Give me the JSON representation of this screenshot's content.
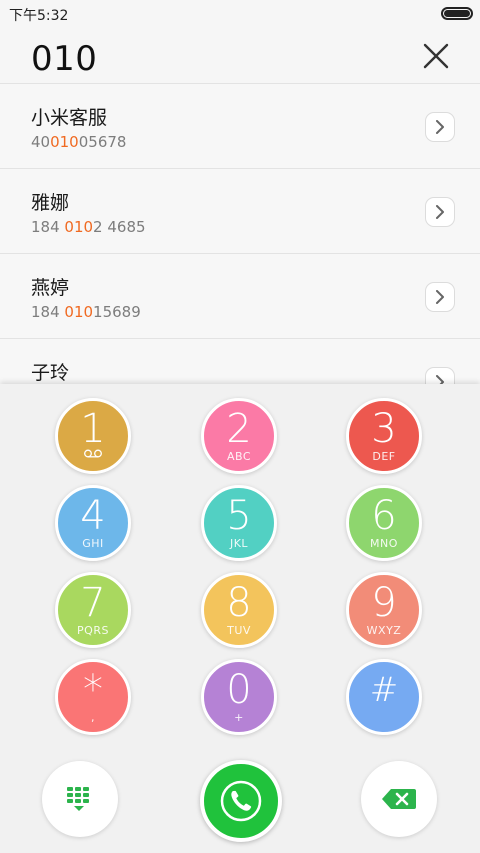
{
  "status_bar": {
    "time": "下午5:32"
  },
  "dial_input": {
    "value": "010"
  },
  "results": [
    {
      "name": "小米客服",
      "number_pre": "40",
      "number_match": "010",
      "number_post": "05678"
    },
    {
      "name": "雅娜",
      "number_pre": "184 ",
      "number_match": "010",
      "number_post": "2 4685"
    },
    {
      "name": "燕婷",
      "number_pre": "184 ",
      "number_match": "010",
      "number_post": "15689"
    },
    {
      "name": "子玲",
      "number_pre": "",
      "number_match": "",
      "number_post": ""
    }
  ],
  "keys": [
    {
      "digit": "1",
      "letters": "",
      "color": "#dba945"
    },
    {
      "digit": "2",
      "letters": "ABC",
      "color": "#fb7aa6"
    },
    {
      "digit": "3",
      "letters": "DEF",
      "color": "#ed584f"
    },
    {
      "digit": "4",
      "letters": "GHI",
      "color": "#6db7ea"
    },
    {
      "digit": "5",
      "letters": "JKL",
      "color": "#52d0c3"
    },
    {
      "digit": "6",
      "letters": "MNO",
      "color": "#8ed66e"
    },
    {
      "digit": "7",
      "letters": "PQRS",
      "color": "#a9d85f"
    },
    {
      "digit": "8",
      "letters": "TUV",
      "color": "#f3c45c"
    },
    {
      "digit": "9",
      "letters": "WXYZ",
      "color": "#f28c78"
    },
    {
      "digit": "*",
      "letters": ",",
      "color": "#fa7575"
    },
    {
      "digit": "0",
      "letters": "+",
      "color": "#b582d5"
    },
    {
      "digit": "#",
      "letters": "",
      "color": "#76aaf2"
    }
  ],
  "colors": {
    "call_green": "#20c23c",
    "match_orange": "#f06a22",
    "icon_green": "#2cb44c"
  },
  "icons": {
    "voicemail": "voicemail-icon",
    "keypad": "keypad-icon",
    "call": "phone-icon",
    "backspace": "backspace-icon"
  }
}
